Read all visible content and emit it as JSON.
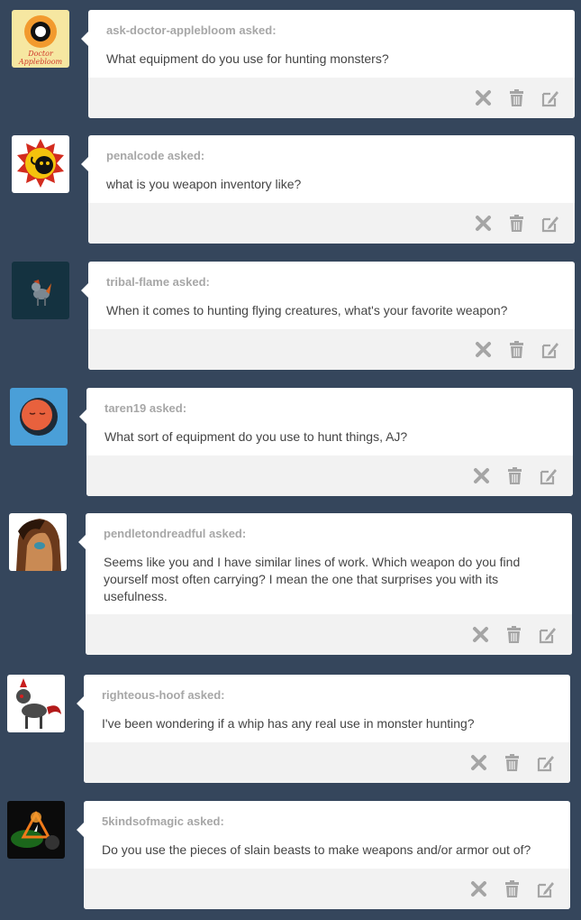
{
  "posts": [
    {
      "asker": "ask-doctor-applebloom asked:",
      "question": "What equipment do you use for hunting monsters?",
      "avatar_text": [
        "Doctor",
        "Applebloom"
      ]
    },
    {
      "asker": "penalcode asked:",
      "question": "what is you weapon inventory like?"
    },
    {
      "asker": "tribal-flame asked:",
      "question": "When it comes to hunting flying creatures, what's your favorite weapon?"
    },
    {
      "asker": "taren19 asked:",
      "question": "What sort of equipment do you use to hunt things, AJ?"
    },
    {
      "asker": "pendletondreadful asked:",
      "question": "Seems like you and I have similar lines of work. Which weapon do you find yourself most often carrying? I mean the one that surprises you with its usefulness."
    },
    {
      "asker": "righteous-hoof asked:",
      "question": "I've been wondering if a whip has any real use in monster hunting?"
    },
    {
      "asker": "5kindsofmagic asked:",
      "question": "Do you use the pieces of slain beasts to make weapons and/or armor out of?"
    }
  ],
  "icons": {
    "delete": "close-icon",
    "trash": "trash-icon",
    "edit": "edit-icon"
  },
  "colors": {
    "background": "#35465c",
    "card": "#ffffff",
    "footer": "#f2f2f2",
    "asker": "#a7a7a7",
    "icon": "#a5a5a5"
  }
}
